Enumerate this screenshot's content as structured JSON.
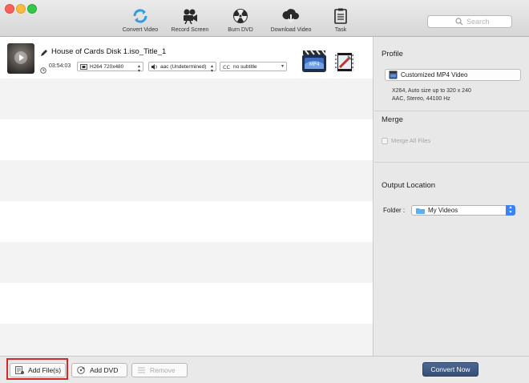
{
  "toolbar": {
    "convert_video": "Convert Video",
    "record_screen": "Record Screen",
    "burn_dvd": "Burn DVD",
    "download_video": "Download Video",
    "task": "Task",
    "search_placeholder": "Search"
  },
  "file": {
    "name": "House of Cards Disk 1.iso_Title_1",
    "duration": "03:54:03",
    "video_track": "H264 720x480",
    "audio_track": "aac (Undetermined)",
    "subtitle": "no subtitle"
  },
  "panel": {
    "profile_title": "Profile",
    "profile_value": "Customized MP4 Video",
    "profile_desc_line1": "X264, Auto size up to 320 x 240",
    "profile_desc_line2": "AAC, Stereo, 44100 Hz",
    "merge_title": "Merge",
    "merge_label": "Merge All Files",
    "output_title": "Output Location",
    "folder_label": "Folder :",
    "folder_value": "My Videos"
  },
  "bottom": {
    "add_files": "Add File(s)",
    "add_dvd": "Add DVD",
    "remove": "Remove",
    "convert_now": "Convert Now"
  },
  "colors": {
    "accent": "#3b82f6",
    "convert_button": "#3f5883",
    "highlight": "#d12a2a"
  }
}
